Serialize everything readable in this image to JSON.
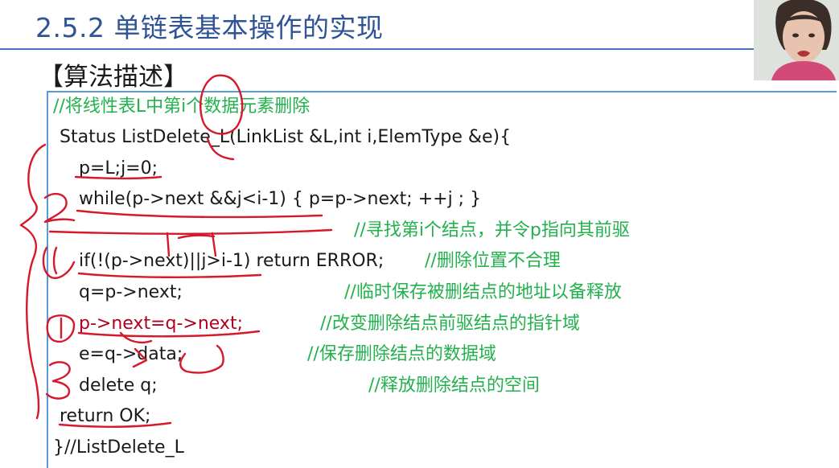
{
  "title": "2.5.2 单链表基本操作的实现",
  "subtitle": "【算法描述】",
  "code": {
    "comment_header": "//将线性表L中第i个数据元素删除",
    "signature": "Status ListDelete_L(LinkList &L,int i,ElemType &e){",
    "line_init": "p=L;j=0;",
    "line_while": "while(p->next &&j<i-1) { p=p->next;  ++j ;  }",
    "comment_find": "//寻找第i个结点，并令p指向其前驱",
    "line_if": "if(!(p->next)||j>i-1) return ERROR;",
    "comment_if": "//删除位置不合理",
    "line_q": "q=p->next;",
    "comment_q": "//临时保存被删结点的地址以备释放",
    "line_link": "p->next=q->next;",
    "comment_link": "//改变删除结点前驱结点的指针域",
    "line_data": "e=q->data;",
    "comment_data": "//保存删除结点的数据域",
    "line_delete": "delete q;",
    "comment_delete": "//释放删除结点的空间",
    "line_return": "return OK;",
    "line_end": "}//ListDelete_L"
  },
  "colors": {
    "title": "#2f5496",
    "comment": "#22b14c",
    "ink": "#d6182b",
    "border": "#5b9bd5"
  }
}
